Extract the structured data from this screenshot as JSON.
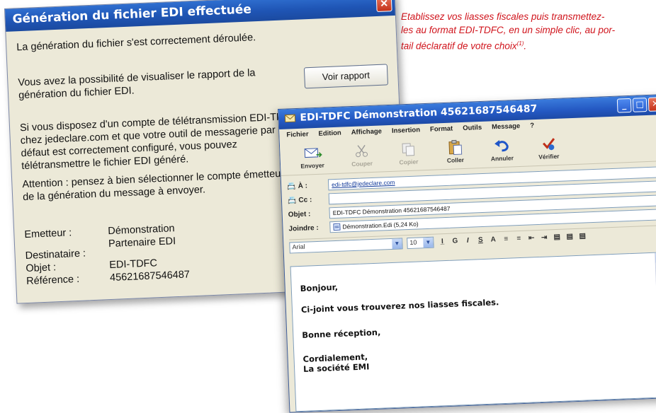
{
  "caption": {
    "line1": "Etablissez vos liasses fiscales puis transmettez-",
    "line2": "les au format EDI-TDFC, en un simple clic, au por-",
    "line3": "tail déclaratif de votre choix",
    "footnote": "(1)",
    "line3_end": "."
  },
  "dialog_generation": {
    "title": "Génération du fichier EDI effectuée",
    "close_label": "✕",
    "msg_success": "La génération du fichier s'est correctement déroulée.",
    "msg_view_1": "Vous avez la possibilité de visualiser le rapport de la",
    "msg_view_2": "génération du fichier EDI.",
    "view_button": "Voir rapport",
    "msg_account_1": "Si vous disposez d'un compte de télétransmission EDI-TDFC",
    "msg_account_2": "chez jedeclare.com et que votre outil de messagerie par",
    "msg_account_3": "défaut est correctement configuré, vous pouvez",
    "msg_account_4": "télétransmettre le fichier EDI généré.",
    "msg_warning_1": "Attention : pensez à bien sélectionner le compte émetteur lors",
    "msg_warning_2": "de la génération du  message à envoyer.",
    "fields": [
      {
        "label": "Emetteur :",
        "value": "Démonstration"
      },
      {
        "label": "",
        "value": "Partenaire EDI"
      },
      {
        "label": "Destinataire :",
        "value": ""
      },
      {
        "label": "Objet :",
        "value": "EDI-TDFC"
      },
      {
        "label": "Référence :",
        "value": "45621687546487"
      }
    ]
  },
  "dialog_email": {
    "title": "EDI-TDFC Démonstration 45621687546487",
    "menu": [
      "Fichier",
      "Edition",
      "Affichage",
      "Insertion",
      "Format",
      "Outils",
      "Message",
      "?"
    ],
    "toolbar": [
      {
        "label": "Envoyer",
        "icon": "send-icon",
        "enabled": true
      },
      {
        "label": "Couper",
        "icon": "scissors-icon",
        "enabled": false
      },
      {
        "label": "Copier",
        "icon": "copy-icon",
        "enabled": false
      },
      {
        "label": "Coller",
        "icon": "paste-icon",
        "enabled": true
      },
      {
        "label": "Annuler",
        "icon": "undo-icon",
        "enabled": true
      },
      {
        "label": "Vérifier",
        "icon": "spellcheck-icon",
        "enabled": true
      }
    ],
    "to_label": "À :",
    "to_value": "edi-tdfc@jedeclare.com",
    "cc_label": "Cc :",
    "cc_value": "",
    "subject_label": "Objet :",
    "subject_value": "EDI-TDFC Démonstration 45621687546487",
    "attach_label": "Joindre :",
    "attach_value": "Démonstration.Edi (5,24 Ko)",
    "font_value": "Arial",
    "size_value": "10",
    "body": {
      "greeting": "Bonjour,",
      "line1": "Ci-joint vous trouverez nos liasses fiscales.",
      "line2": "Bonne réception,",
      "sign1": "Cordialement,",
      "sign2": "La société EMI"
    }
  }
}
